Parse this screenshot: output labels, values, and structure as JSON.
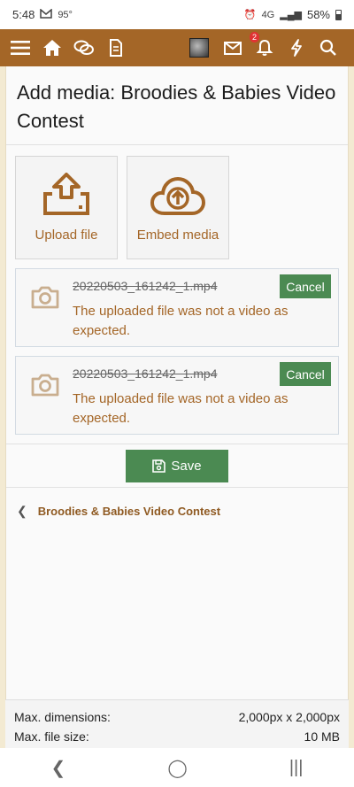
{
  "status_bar": {
    "time": "5:48",
    "gmail_icon": "gmail-icon",
    "temperature": "95°",
    "network": "4G",
    "battery_percent": "58%"
  },
  "nav": {
    "notification_count": "2",
    "icons": [
      "menu-icon",
      "home-icon",
      "chat-icon",
      "document-icon",
      "mail-icon",
      "bell-icon",
      "lightning-icon",
      "search-icon"
    ],
    "accent_color": "#a46627"
  },
  "page": {
    "title": "Add media: Broodies & Babies Video Contest",
    "tiles": [
      {
        "label": "Upload file",
        "icon": "upload-icon"
      },
      {
        "label": "Embed media",
        "icon": "cloud-upload-icon"
      }
    ],
    "uploads": [
      {
        "filename": "20220503_161242_1.mp4",
        "cancel": "Cancel",
        "message": "The uploaded file was not a video as expected."
      },
      {
        "filename": "20220503_161242_1.mp4",
        "cancel": "Cancel",
        "message": "The uploaded file was not a video as expected."
      }
    ],
    "save_label": "Save",
    "breadcrumb": "Broodies & Babies Video Contest",
    "button_color": "#4b8a52"
  },
  "limits": {
    "dimensions_label": "Max. dimensions:",
    "dimensions_value": "2,000px x 2,000px",
    "filesize_label": "Max. file size:",
    "filesize_value": "10 MB"
  }
}
